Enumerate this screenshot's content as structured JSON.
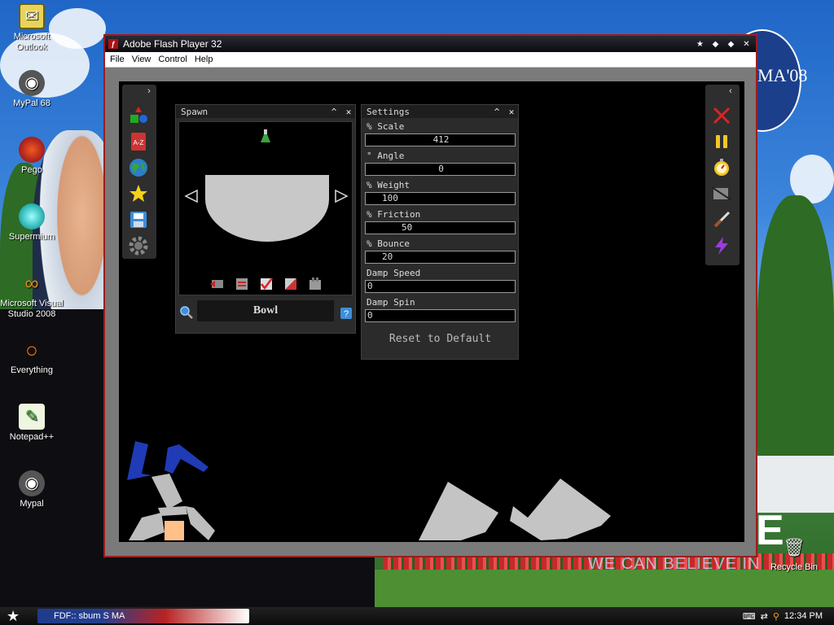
{
  "desktop": {
    "icons": [
      {
        "label": "Microsoft Outlook",
        "icon": "outlook-icon"
      },
      {
        "label": "MyPal 68",
        "icon": "mypal-icon"
      },
      {
        "label": "Pego",
        "icon": "pego-icon"
      },
      {
        "label": "Supermium",
        "icon": "supermium-icon"
      },
      {
        "label": "Microsoft Visual Studio 2008",
        "icon": "visual-studio-icon"
      },
      {
        "label": "Everything",
        "icon": "everything-icon"
      },
      {
        "label": "Notepad++",
        "icon": "notepadpp-icon"
      },
      {
        "label": "Mypal",
        "icon": "mypal-icon"
      }
    ],
    "recycle_bin": "Recycle Bin",
    "wallpaper_text": "WE CAN BELIEVE IN",
    "wallpaper_logo": "MA'08"
  },
  "window": {
    "title": "Adobe Flash Player 32",
    "menu": [
      "File",
      "View",
      "Control",
      "Help"
    ]
  },
  "spawn": {
    "title": "Spawn",
    "item_name": "Bowl"
  },
  "settings": {
    "title": "Settings",
    "fields": [
      {
        "label": "% Scale",
        "value": "412"
      },
      {
        "label": "° Angle",
        "value": "0"
      },
      {
        "label": "% Weight",
        "value": "100"
      },
      {
        "label": "% Friction",
        "value": "50"
      },
      {
        "label": "% Bounce",
        "value": "20"
      },
      {
        "label": "Damp Speed",
        "value": "0"
      },
      {
        "label": "Damp Spin",
        "value": "0"
      }
    ],
    "reset_label": "Reset to Default"
  },
  "taskbar": {
    "task_label": "FDF:: sbum S MA",
    "clock": "12:34 PM"
  },
  "colors": {
    "stage": "#000000",
    "panel": "#2b2b2b",
    "shape": "#c4c4c4",
    "window_border": "#9c1d1d"
  }
}
